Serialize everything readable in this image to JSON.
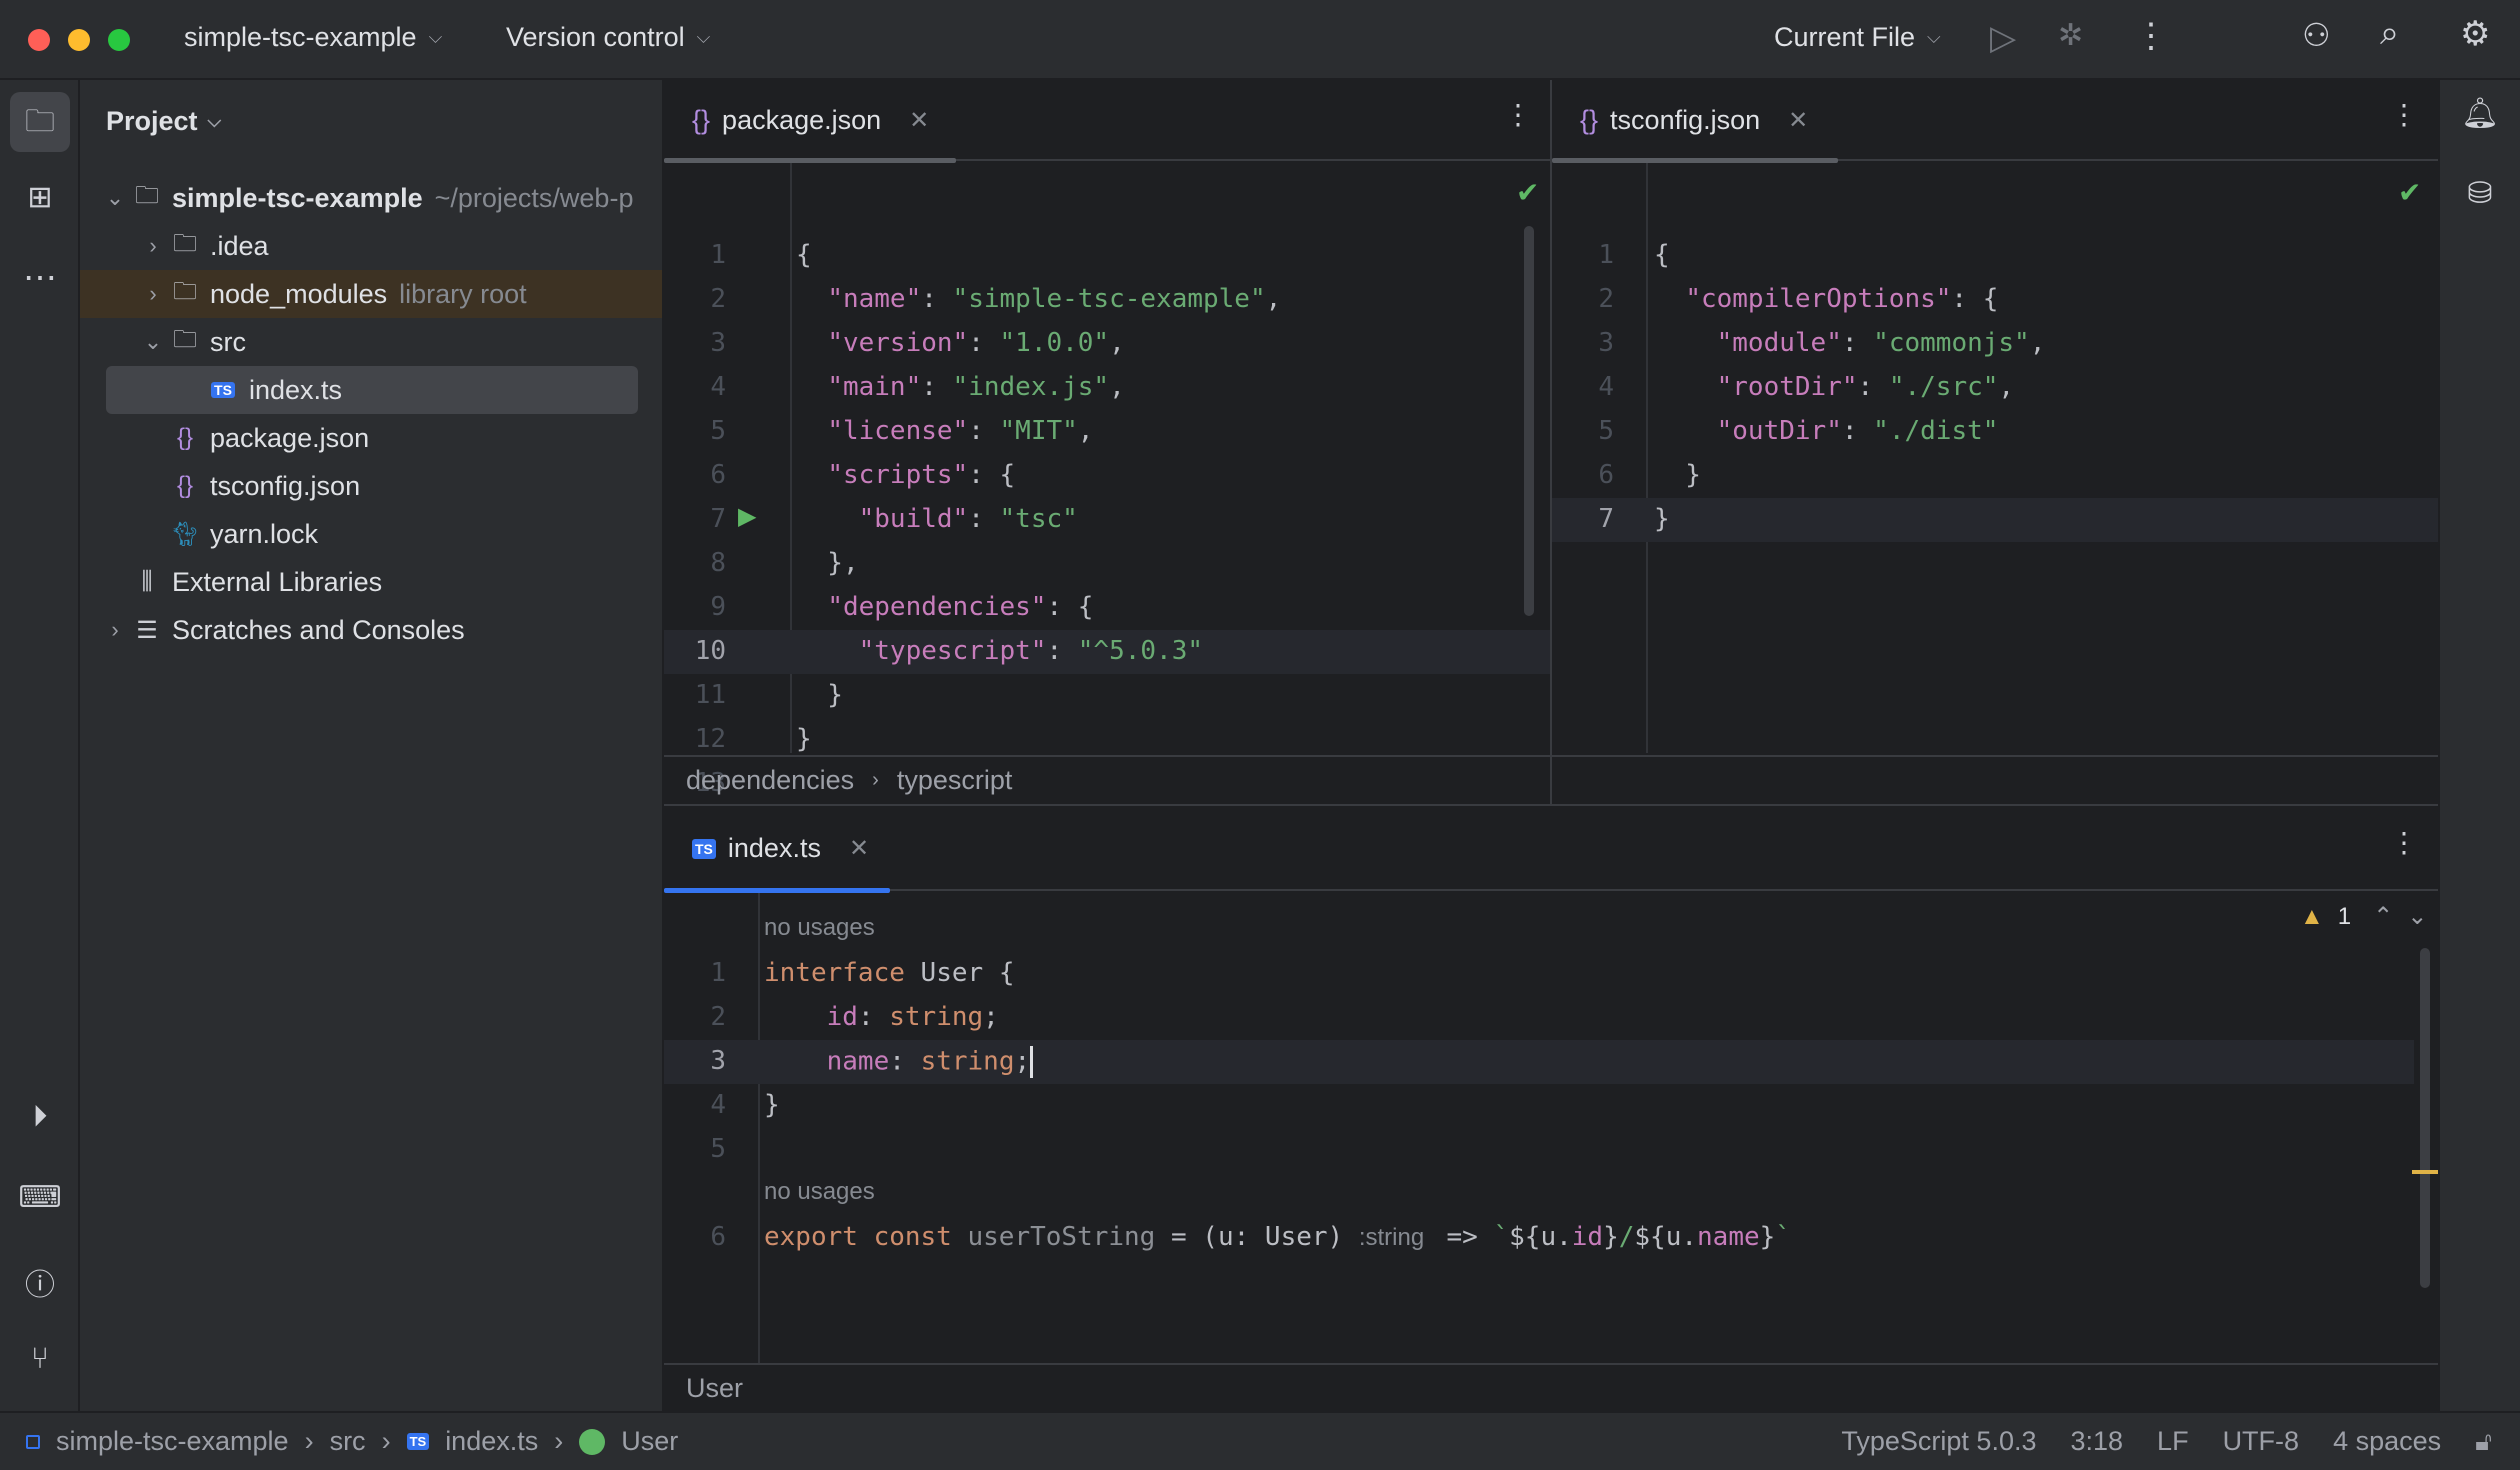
{
  "titlebar": {
    "project": "simple-tsc-example",
    "vcs": "Version control",
    "run_config": "Current File"
  },
  "project_panel": {
    "title": "Project",
    "items": [
      {
        "label": "simple-tsc-example",
        "hint": "~/projects/web-p",
        "icon": "project-folder",
        "arrow": "v",
        "indent": 0
      },
      {
        "label": ".idea",
        "hint": "",
        "icon": "folder",
        "arrow": ">",
        "indent": 1
      },
      {
        "label": "node_modules",
        "hint": "library root",
        "icon": "folder",
        "arrow": ">",
        "indent": 1
      },
      {
        "label": "src",
        "hint": "",
        "icon": "folder",
        "arrow": "v",
        "indent": 1
      },
      {
        "label": "index.ts",
        "hint": "",
        "icon": "ts",
        "arrow": "",
        "indent": 2
      },
      {
        "label": "package.json",
        "hint": "",
        "icon": "json",
        "arrow": "",
        "indent": 1
      },
      {
        "label": "tsconfig.json",
        "hint": "",
        "icon": "json",
        "arrow": "",
        "indent": 1
      },
      {
        "label": "yarn.lock",
        "hint": "",
        "icon": "yarn",
        "arrow": "",
        "indent": 1
      },
      {
        "label": "External Libraries",
        "hint": "",
        "icon": "library",
        "arrow": "",
        "indent": 0
      },
      {
        "label": "Scratches and Consoles",
        "hint": "",
        "icon": "scratches",
        "arrow": ">",
        "indent": 0
      }
    ]
  },
  "editor_left": {
    "tab": "package.json",
    "breadcrumb": [
      "dependencies",
      "typescript"
    ],
    "current_line": 10,
    "lines": [
      [
        [
          "{",
          "t"
        ]
      ],
      [
        [
          "  ",
          "t"
        ],
        [
          "\"name\"",
          "p"
        ],
        [
          ": ",
          "t"
        ],
        [
          "\"simple-tsc-example\"",
          "s"
        ],
        [
          ",",
          "t"
        ]
      ],
      [
        [
          "  ",
          "t"
        ],
        [
          "\"version\"",
          "p"
        ],
        [
          ": ",
          "t"
        ],
        [
          "\"1.0.0\"",
          "s"
        ],
        [
          ",",
          "t"
        ]
      ],
      [
        [
          "  ",
          "t"
        ],
        [
          "\"main\"",
          "p"
        ],
        [
          ": ",
          "t"
        ],
        [
          "\"index.js\"",
          "s"
        ],
        [
          ",",
          "t"
        ]
      ],
      [
        [
          "  ",
          "t"
        ],
        [
          "\"license\"",
          "p"
        ],
        [
          ": ",
          "t"
        ],
        [
          "\"MIT\"",
          "s"
        ],
        [
          ",",
          "t"
        ]
      ],
      [
        [
          "  ",
          "t"
        ],
        [
          "\"scripts\"",
          "p"
        ],
        [
          ": {",
          "t"
        ]
      ],
      [
        [
          "    ",
          "t"
        ],
        [
          "\"build\"",
          "p"
        ],
        [
          ": ",
          "t"
        ],
        [
          "\"tsc\"",
          "s"
        ]
      ],
      [
        [
          "  },",
          "t"
        ]
      ],
      [
        [
          "  ",
          "t"
        ],
        [
          "\"dependencies\"",
          "p"
        ],
        [
          ": {",
          "t"
        ]
      ],
      [
        [
          "    ",
          "t"
        ],
        [
          "\"typescript\"",
          "p"
        ],
        [
          ": ",
          "t"
        ],
        [
          "\"^5.0.3\"",
          "s"
        ]
      ],
      [
        [
          "  }",
          "t"
        ]
      ],
      [
        [
          "}",
          "t"
        ]
      ],
      []
    ]
  },
  "editor_right": {
    "tab": "tsconfig.json",
    "current_line": 7,
    "lines": [
      [
        [
          "{",
          "t"
        ]
      ],
      [
        [
          "  ",
          "t"
        ],
        [
          "\"compilerOptions\"",
          "p"
        ],
        [
          ": {",
          "t"
        ]
      ],
      [
        [
          "    ",
          "t"
        ],
        [
          "\"module\"",
          "p"
        ],
        [
          ": ",
          "t"
        ],
        [
          "\"commonjs\"",
          "s"
        ],
        [
          ",",
          "t"
        ]
      ],
      [
        [
          "    ",
          "t"
        ],
        [
          "\"rootDir\"",
          "p"
        ],
        [
          ": ",
          "t"
        ],
        [
          "\"./src\"",
          "s"
        ],
        [
          ",",
          "t"
        ]
      ],
      [
        [
          "    ",
          "t"
        ],
        [
          "\"outDir\"",
          "p"
        ],
        [
          ": ",
          "t"
        ],
        [
          "\"./dist\"",
          "s"
        ]
      ],
      [
        [
          "  }",
          "t"
        ]
      ],
      [
        [
          "}",
          "t"
        ]
      ]
    ]
  },
  "editor_bottom": {
    "tab": "index.ts",
    "warnings": "1",
    "breadcrumb": "User",
    "hint_no_usages": "no usages",
    "current_line": 3,
    "lines": [
      {
        "n": "1",
        "tokens": [
          [
            "interface ",
            "k"
          ],
          [
            "User {",
            "t"
          ]
        ],
        "hint": true
      },
      {
        "n": "2",
        "tokens": [
          [
            "    ",
            "t"
          ],
          [
            "id",
            "p"
          ],
          [
            ": ",
            "t"
          ],
          [
            "string",
            "k"
          ],
          [
            ";",
            "t"
          ]
        ]
      },
      {
        "n": "3",
        "tokens": [
          [
            "    ",
            "t"
          ],
          [
            "name",
            "p"
          ],
          [
            ": ",
            "t"
          ],
          [
            "string",
            "k"
          ],
          [
            ";",
            "t"
          ]
        ]
      },
      {
        "n": "4",
        "tokens": [
          [
            "}",
            "t"
          ]
        ]
      },
      {
        "n": "5",
        "tokens": []
      },
      {
        "n": "6",
        "tokens": [
          [
            "export const ",
            "k"
          ],
          [
            "userToString",
            "f"
          ],
          [
            " = (u: User) ",
            "t"
          ],
          [
            ":string ",
            "h"
          ],
          [
            " => ",
            "t"
          ],
          [
            "`",
            "s"
          ],
          [
            "${u.",
            "t"
          ],
          [
            "id",
            "p"
          ],
          [
            "}",
            "t"
          ],
          [
            "/",
            "s"
          ],
          [
            "${u.",
            "t"
          ],
          [
            "name",
            "p"
          ],
          [
            "}",
            "t"
          ],
          [
            "`",
            "s"
          ]
        ],
        "hint": true
      }
    ]
  },
  "status": {
    "path": [
      "simple-tsc-example",
      "src",
      "index.ts",
      "User"
    ],
    "language": "TypeScript 5.0.3",
    "position": "3:18",
    "line_sep": "LF",
    "encoding": "UTF-8",
    "indent": "4 spaces"
  },
  "colors": {
    "accent": "#3574f0",
    "selection": "#43454a",
    "library_bg": "#3d3223"
  }
}
